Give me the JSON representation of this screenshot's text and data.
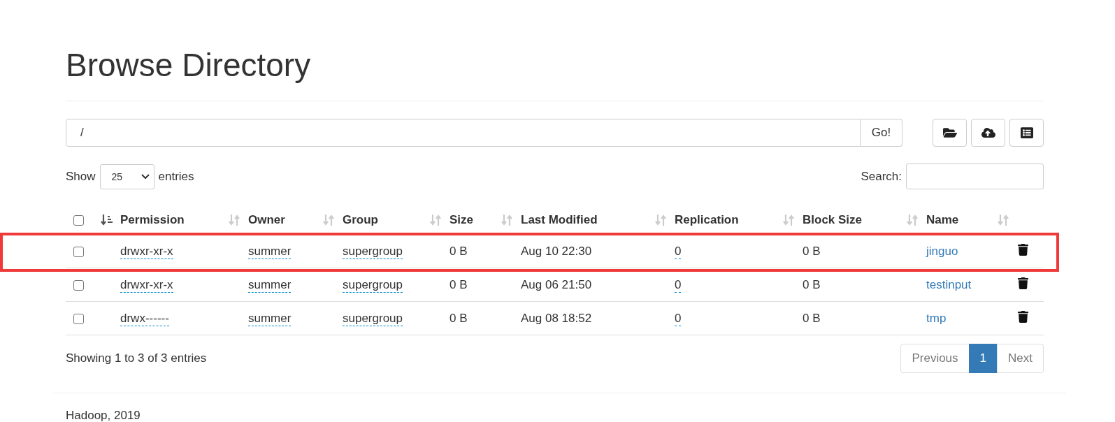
{
  "title": "Browse Directory",
  "path_field": {
    "value": "/"
  },
  "go_button": "Go!",
  "show_entries": {
    "before": "Show",
    "value": "25",
    "after": "entries"
  },
  "search": {
    "label": "Search:"
  },
  "table": {
    "select_all": {
      "checked": false
    },
    "columns": [
      {
        "sorted": true
      },
      {
        "label": "Permission",
        "sorted": false
      },
      {
        "label": "Owner",
        "sorted": false
      },
      {
        "label": "Group",
        "sorted": false
      },
      {
        "label": "Size",
        "sorted": false
      },
      {
        "label": "Last Modified",
        "sorted": false
      },
      {
        "label": "Replication",
        "sorted": false
      },
      {
        "label": "Block Size",
        "sorted": false
      },
      {
        "label": "Name",
        "sorted": false
      }
    ],
    "rows": [
      {
        "checked": false,
        "highlighted": true,
        "permission": "drwxr-xr-x",
        "owner": "summer",
        "group": "supergroup",
        "size": "0 B",
        "last_modified": "Aug 10 22:30",
        "replication": "0",
        "block_size": "0 B",
        "name": "jinguo"
      },
      {
        "checked": false,
        "highlighted": false,
        "permission": "drwxr-xr-x",
        "owner": "summer",
        "group": "supergroup",
        "size": "0 B",
        "last_modified": "Aug 06 21:50",
        "replication": "0",
        "block_size": "0 B",
        "name": "testinput"
      },
      {
        "checked": false,
        "highlighted": false,
        "permission": "drwx------",
        "owner": "summer",
        "group": "supergroup",
        "size": "0 B",
        "last_modified": "Aug 08 18:52",
        "replication": "0",
        "block_size": "0 B",
        "name": "tmp"
      }
    ]
  },
  "info": "Showing 1 to 3 of 3 entries",
  "pagination": [
    {
      "label": "Previous",
      "selected": false
    },
    {
      "label": "1",
      "selected": true
    },
    {
      "label": "Next",
      "selected": false
    }
  ],
  "footer": "Hadoop, 2019"
}
